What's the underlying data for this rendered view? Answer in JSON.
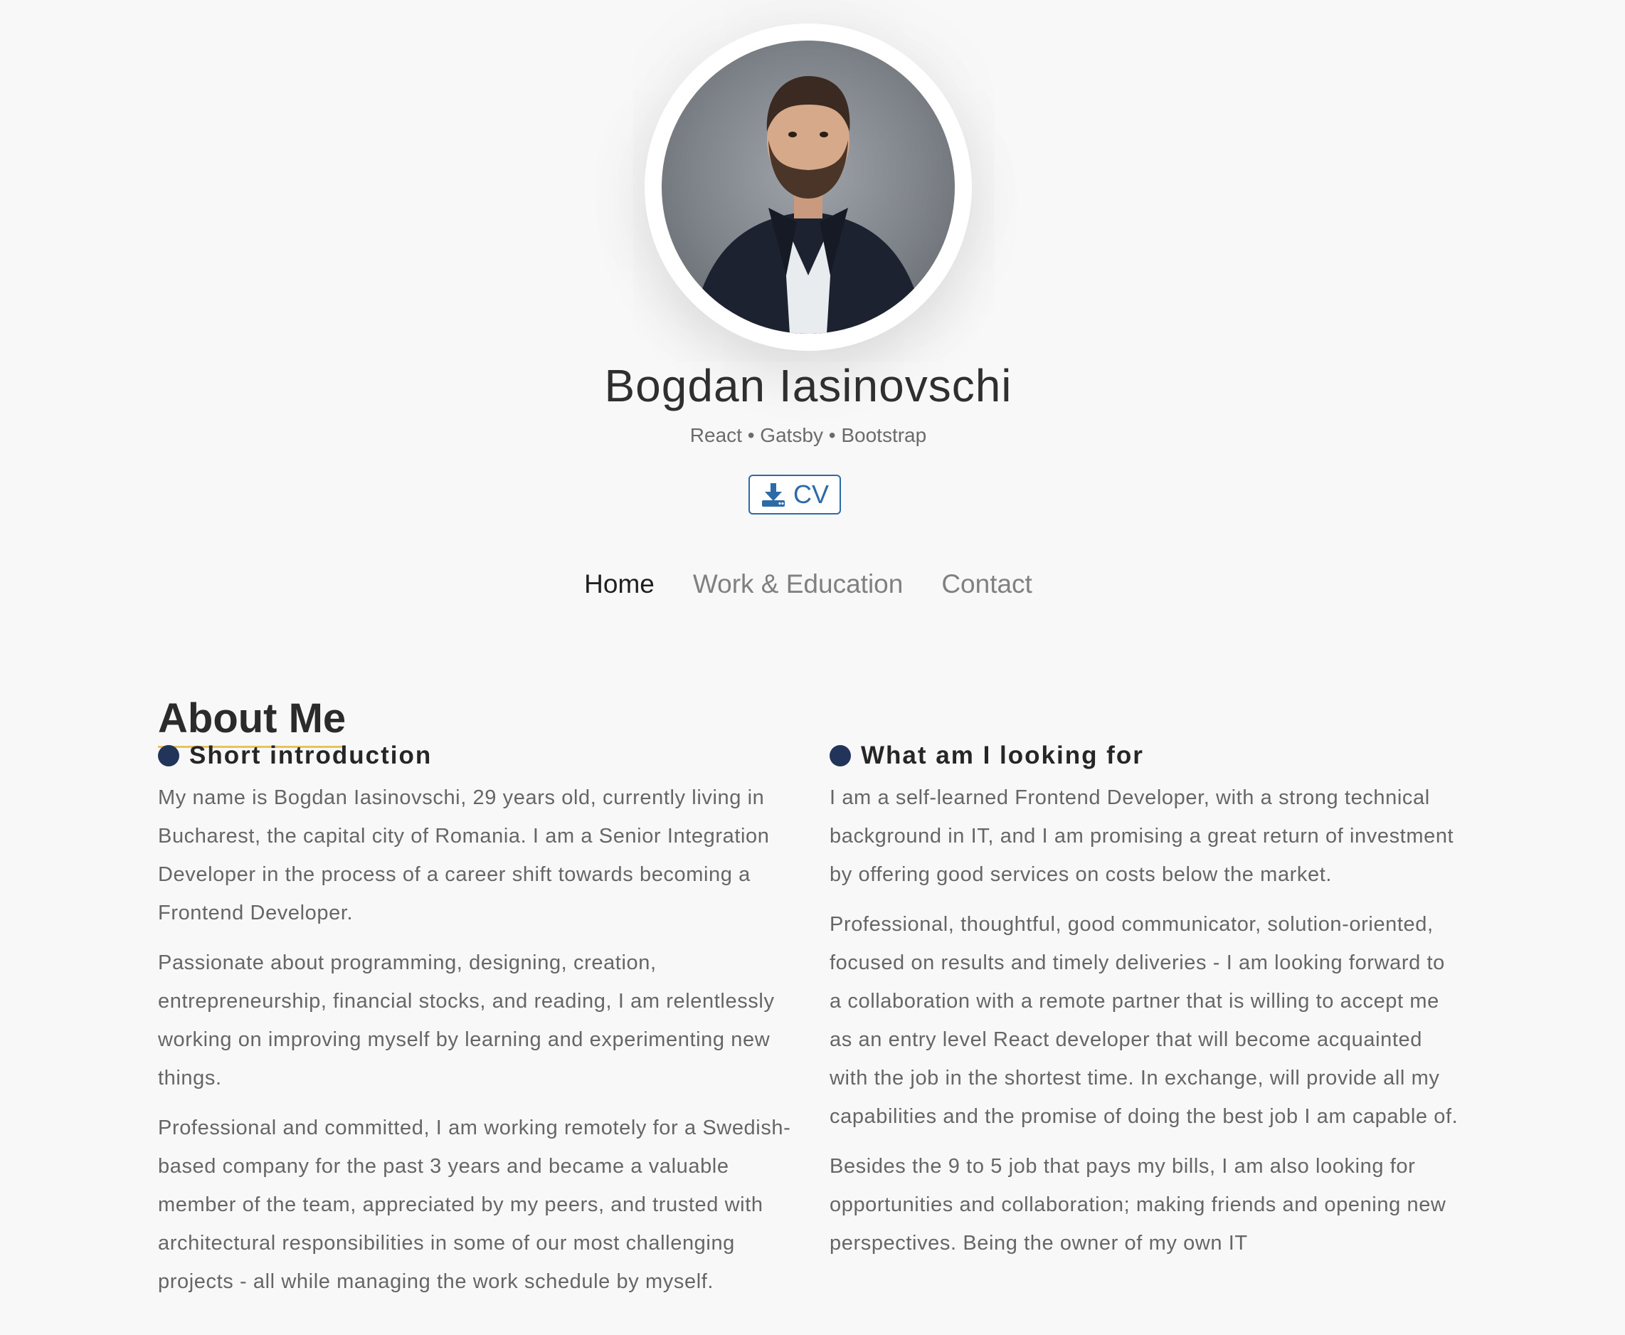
{
  "profile": {
    "name": "Bogdan Iasinovschi",
    "tagline": "React • Gatsby • Bootstrap",
    "cv_label": "CV"
  },
  "nav": {
    "items": [
      {
        "label": "Home",
        "active": true
      },
      {
        "label": "Work & Education",
        "active": false
      },
      {
        "label": "Contact",
        "active": false
      }
    ]
  },
  "about": {
    "title": "About Me",
    "intro": {
      "heading": "Short introduction",
      "paragraphs": [
        "My name is Bogdan Iasinovschi, 29 years old, currently living in Bucharest, the capital city of Romania. I am a Senior Integration Developer in the process of a career shift towards becoming a Frontend Developer.",
        "Passionate about programming, designing, creation, entrepreneurship, financial stocks, and reading, I am relentlessly working on improving myself by learning and experimenting new things.",
        "Professional and committed, I am working remotely for a Swedish-based company for the past 3 years and became a valuable member of the team, appreciated by my peers, and trusted with architectural responsibilities in some of our most challenging projects - all while managing the work schedule by myself."
      ]
    },
    "looking": {
      "heading": "What am I looking for",
      "paragraphs": [
        "I am a self-learned Frontend Developer, with a strong technical background in IT, and I am promising a great return of investment by offering good services on costs below the market.",
        "Professional, thoughtful, good communicator, solution-oriented, focused on results and timely deliveries -  I am looking forward to a collaboration with a remote partner that is willing to accept me as an entry level React developer that will become acquainted with the job in the shortest time. In exchange, will provide all my capabilities and the promise of doing the best job I am capable of.",
        "Besides the 9 to 5 job that pays my bills, I am also looking for opportunities and collaboration; making friends and opening new perspectives. Being the owner of my own IT"
      ]
    }
  },
  "colors": {
    "accent": "#2d6aa8",
    "underline": "#e8c25a",
    "bullet": "#22345a"
  }
}
